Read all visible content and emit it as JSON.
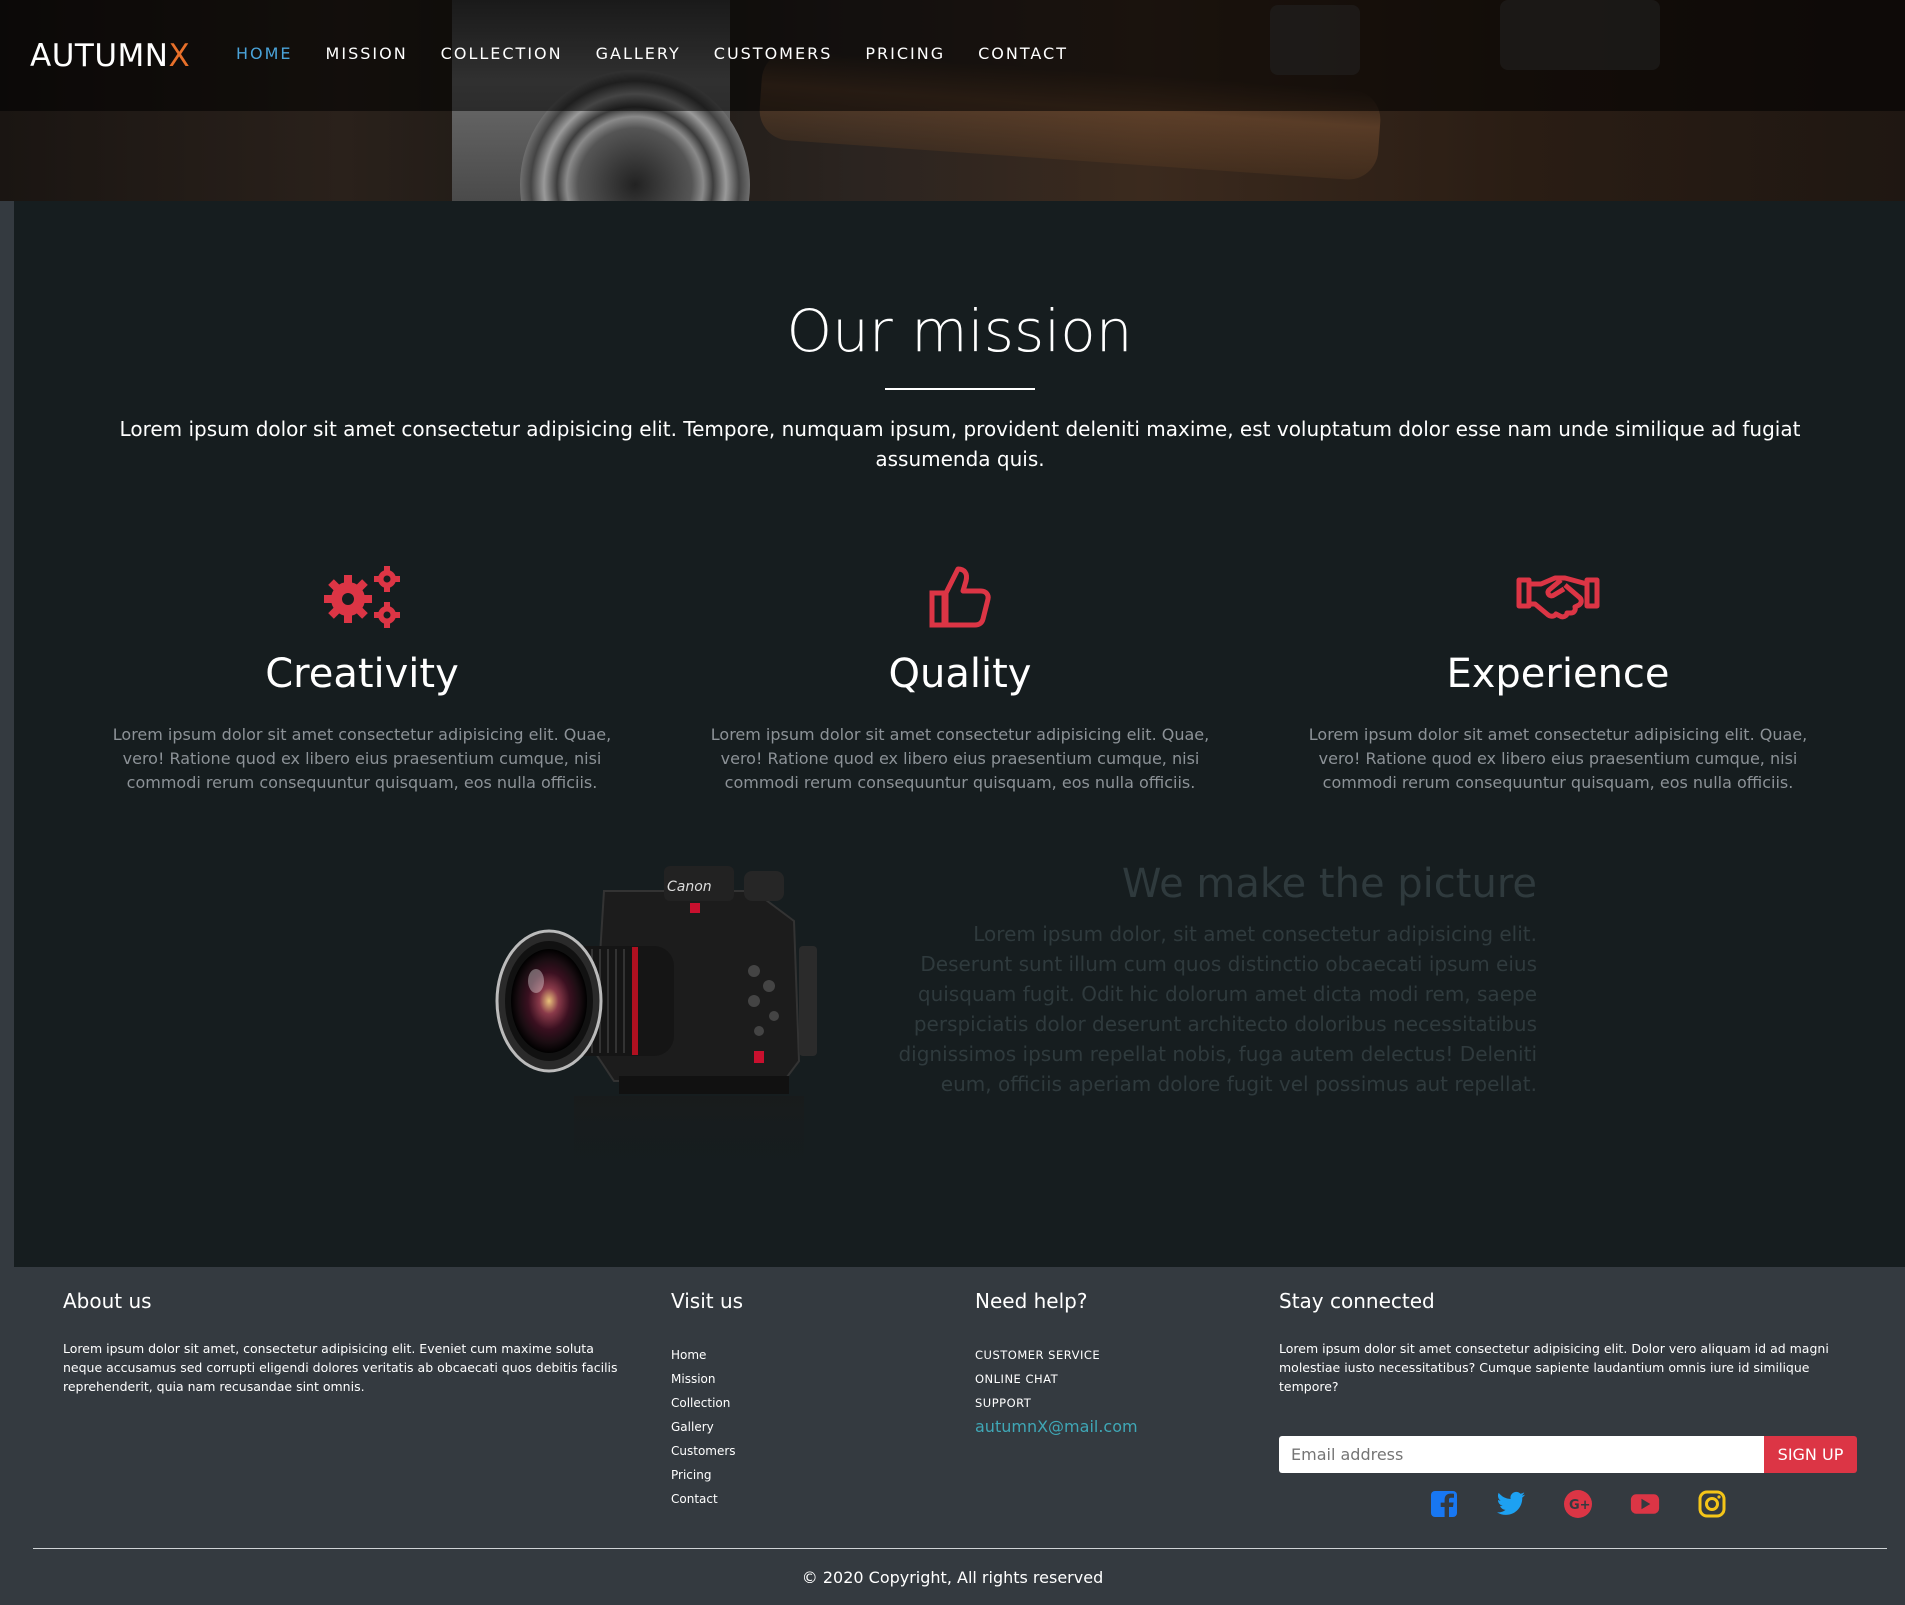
{
  "brand": {
    "name": "AUTUMN",
    "accent": "X",
    "accent_color": "#e8702a"
  },
  "nav": {
    "items": [
      {
        "label": "HOME",
        "active": true
      },
      {
        "label": "MISSION"
      },
      {
        "label": "COLLECTION"
      },
      {
        "label": "GALLERY"
      },
      {
        "label": "CUSTOMERS"
      },
      {
        "label": "PRICING"
      },
      {
        "label": "CONTACT"
      }
    ],
    "active_color": "#4aa3d9"
  },
  "mission": {
    "title": "Our mission",
    "intro": "Lorem ipsum dolor sit amet consectetur adipisicing elit. Tempore, numquam ipsum, provident deleniti maxime, est voluptatum dolor esse nam unde similique ad fugiat assumenda quis.",
    "features": [
      {
        "icon": "gears-icon",
        "title": "Creativity",
        "text": "Lorem ipsum dolor sit amet consectetur adipisicing elit. Quae, vero! Ratione quod ex libero eius praesentium cumque, nisi commodi rerum consequuntur quisquam, eos nulla officiis."
      },
      {
        "icon": "thumbs-up-icon",
        "title": "Quality",
        "text": "Lorem ipsum dolor sit amet consectetur adipisicing elit. Quae, vero! Ratione quod ex libero eius praesentium cumque, nisi commodi rerum consequuntur quisquam, eos nulla officiis."
      },
      {
        "icon": "handshake-icon",
        "title": "Experience",
        "text": "Lorem ipsum dolor sit amet consectetur adipisicing elit. Quae, vero! Ratione quod ex libero eius praesentium cumque, nisi commodi rerum consequuntur quisquam, eos nulla officiis."
      }
    ],
    "icon_color": "#dc3545",
    "picture": {
      "title": "We make the picture",
      "text": "Lorem ipsum dolor, sit amet consectetur adipisicing elit. Deserunt sunt illum cum quos distinctio obcaecati ipsum eius quisquam fugit. Odit hic dolorum amet dicta modi rem, saepe perspiciatis dolor deserunt architecto doloribus necessitatibus dignissimos ipsum repellat nobis, fuga autem delectus! Deleniti eum, officiis aperiam dolore fugit vel possimus aut repellat."
    }
  },
  "footer": {
    "about": {
      "title": "About us",
      "text": "Lorem ipsum dolor sit amet, consectetur adipisicing elit. Eveniet cum maxime soluta neque accusamus sed corrupti eligendi dolores veritatis ab obcaecati quos debitis facilis reprehenderit, quia nam recusandae sint omnis."
    },
    "visit": {
      "title": "Visit us",
      "links": [
        "Home",
        "Mission",
        "Collection",
        "Gallery",
        "Customers",
        "Pricing",
        "Contact"
      ]
    },
    "help": {
      "title": "Need help?",
      "links": [
        "CUSTOMER SERVICE",
        "ONLINE CHAT",
        "SUPPORT"
      ],
      "email": "autumnX@mail.com"
    },
    "stay": {
      "title": "Stay connected",
      "text": "Lorem ipsum dolor sit amet consectetur adipisicing elit. Dolor vero aliquam id ad magni molestiae iusto necessitatibus? Cumque sapiente laudantium omnis iure id similique tempore?",
      "email_placeholder": "Email address",
      "signup_label": "SIGN UP",
      "socials": [
        {
          "icon": "facebook-icon",
          "color": "#1877f2"
        },
        {
          "icon": "twitter-icon",
          "color": "#1da1f2"
        },
        {
          "icon": "google-plus-icon",
          "color": "#dc3545"
        },
        {
          "icon": "youtube-icon",
          "color": "#dc3545"
        },
        {
          "icon": "instagram-icon",
          "color": "#f5c518"
        }
      ]
    },
    "copyright": "© 2020 Copyright, All rights reserved"
  }
}
